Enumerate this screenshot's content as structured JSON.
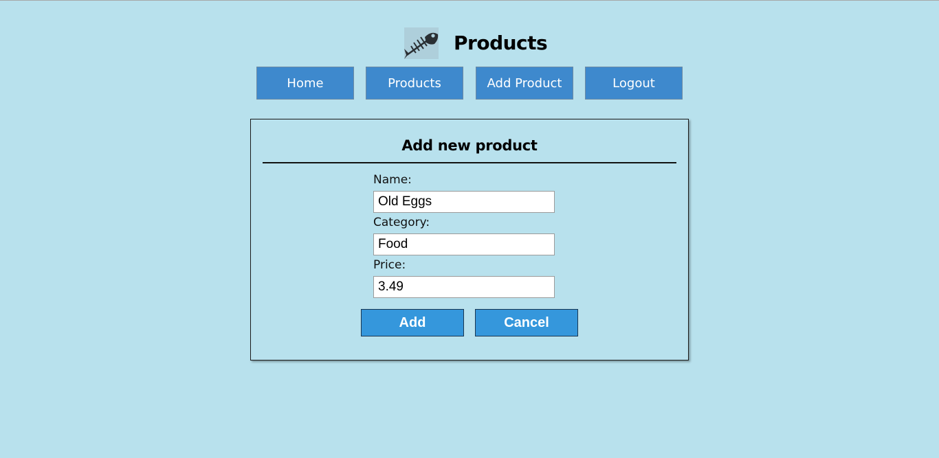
{
  "header": {
    "title": "Products",
    "logo_icon": "fish-skeleton-icon"
  },
  "nav": {
    "items": [
      {
        "label": "Home"
      },
      {
        "label": "Products"
      },
      {
        "label": "Add Product"
      },
      {
        "label": "Logout"
      }
    ]
  },
  "form": {
    "title": "Add new product",
    "fields": {
      "name": {
        "label": "Name:",
        "value": "Old Eggs"
      },
      "category": {
        "label": "Category:",
        "value": "Food"
      },
      "price": {
        "label": "Price:",
        "value": "3.49"
      }
    },
    "add_label": "Add",
    "cancel_label": "Cancel"
  },
  "colors": {
    "background": "#b8e1ed",
    "nav_button": "#3e89cd",
    "action_button": "#3597dc"
  }
}
